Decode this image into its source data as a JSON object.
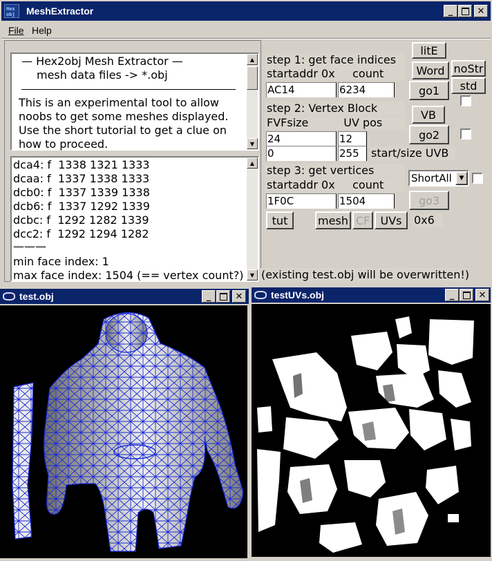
{
  "window": {
    "title": "MeshExtractor",
    "app_icon_text": "Hex obj"
  },
  "menu": {
    "file": "File",
    "help": "Help"
  },
  "info": {
    "line1": "—   Hex2obj Mesh Extractor   —",
    "line2": "mesh data files -> *.obj",
    "para": [
      "This is an experimental tool to allow",
      "noobs to get some meshes displayed.",
      "Use the short tutorial to get a clue on",
      "how to proceed."
    ]
  },
  "log": {
    "lines": [
      "dca4: f  1338 1321 1333",
      "dcaa: f  1337 1338 1333",
      "dcb0: f  1337 1339 1338",
      "dcb6: f  1337 1292 1339",
      "dcbc: f  1292 1282 1339",
      "dcc2: f  1292 1294 1282"
    ],
    "separator": "———",
    "min": "min face index: 1",
    "max": "max face index: 1504 (== vertex count?)"
  },
  "step1": {
    "title": "step 1: get face indices",
    "labels": "startaddr 0x     count",
    "startaddr": "AC14",
    "count": "6234",
    "go": "go1"
  },
  "step2": {
    "title": "step 2: Vertex Block",
    "labels": "FVFsize          UV pos",
    "fvfsize": "24",
    "uvpos": "12",
    "uv_start": "0",
    "uv_size": "255",
    "uvb_label": "start/size UVB",
    "vb": "VB",
    "go": "go2"
  },
  "step3": {
    "title": "step 3: get vertices",
    "labels": "startaddr 0x     count",
    "startaddr": "1F0C",
    "count": "1504",
    "go": "go3",
    "combo": "ShortAll"
  },
  "side": {
    "lite": "litE",
    "word": "Word",
    "nostr": "noStr",
    "std": "std"
  },
  "bottom": {
    "tut": "tut",
    "mesh": "mesh",
    "cf": "CF",
    "uvs": "UVs",
    "ox6": "0x6",
    "warning": "(existing test.obj will be overwritten!)"
  },
  "subwin1": {
    "title": "test.obj"
  },
  "subwin2": {
    "title": "testUVs.obj"
  },
  "colors": {
    "titlebar": "#0a246a",
    "wire": "#1a2ad8"
  }
}
